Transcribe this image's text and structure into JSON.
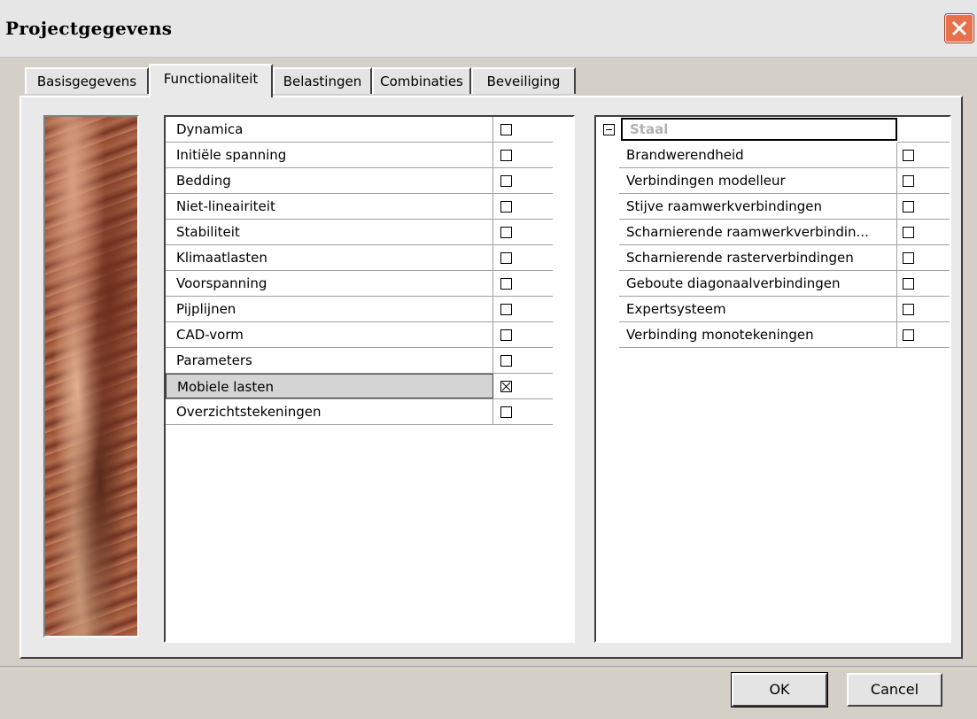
{
  "window": {
    "title": "Projectgegevens",
    "close_icon": "close-icon"
  },
  "tabs": [
    "Basisgegevens",
    "Functionaliteit",
    "Belastingen",
    "Combinaties",
    "Beveiliging"
  ],
  "active_tab": "Functionaliteit",
  "functions": [
    {
      "label": "Dynamica",
      "checked": false
    },
    {
      "label": "Initiële spanning",
      "checked": false
    },
    {
      "label": "Bedding",
      "checked": false
    },
    {
      "label": "Niet-lineairiteit",
      "checked": false
    },
    {
      "label": "Stabiliteit",
      "checked": false
    },
    {
      "label": "Klimaatlasten",
      "checked": false
    },
    {
      "label": "Voorspanning",
      "checked": false
    },
    {
      "label": "Pijplijnen",
      "checked": false
    },
    {
      "label": "CAD-vorm",
      "checked": false
    },
    {
      "label": "Parameters",
      "checked": false
    },
    {
      "label": "Mobiele lasten",
      "checked": true
    },
    {
      "label": "Overzichtstekeningen",
      "checked": false
    }
  ],
  "selected_function": "Mobiele lasten",
  "steel": {
    "group": "Staal",
    "items": [
      {
        "label": "Brandwerendheid",
        "checked": false
      },
      {
        "label": "Verbindingen modelleur",
        "checked": false
      },
      {
        "label": "Stijve raamwerkverbindingen",
        "checked": false
      },
      {
        "label": "Scharnierende raamwerkverbindin...",
        "checked": false
      },
      {
        "label": "Scharnierende rasterverbindingen",
        "checked": false
      },
      {
        "label": "Geboute diagonaalverbindingen",
        "checked": false
      },
      {
        "label": "Expertsysteem",
        "checked": false
      },
      {
        "label": "Verbinding monotekeningen",
        "checked": false
      }
    ]
  },
  "buttons": {
    "ok": "OK",
    "cancel": "Cancel"
  }
}
